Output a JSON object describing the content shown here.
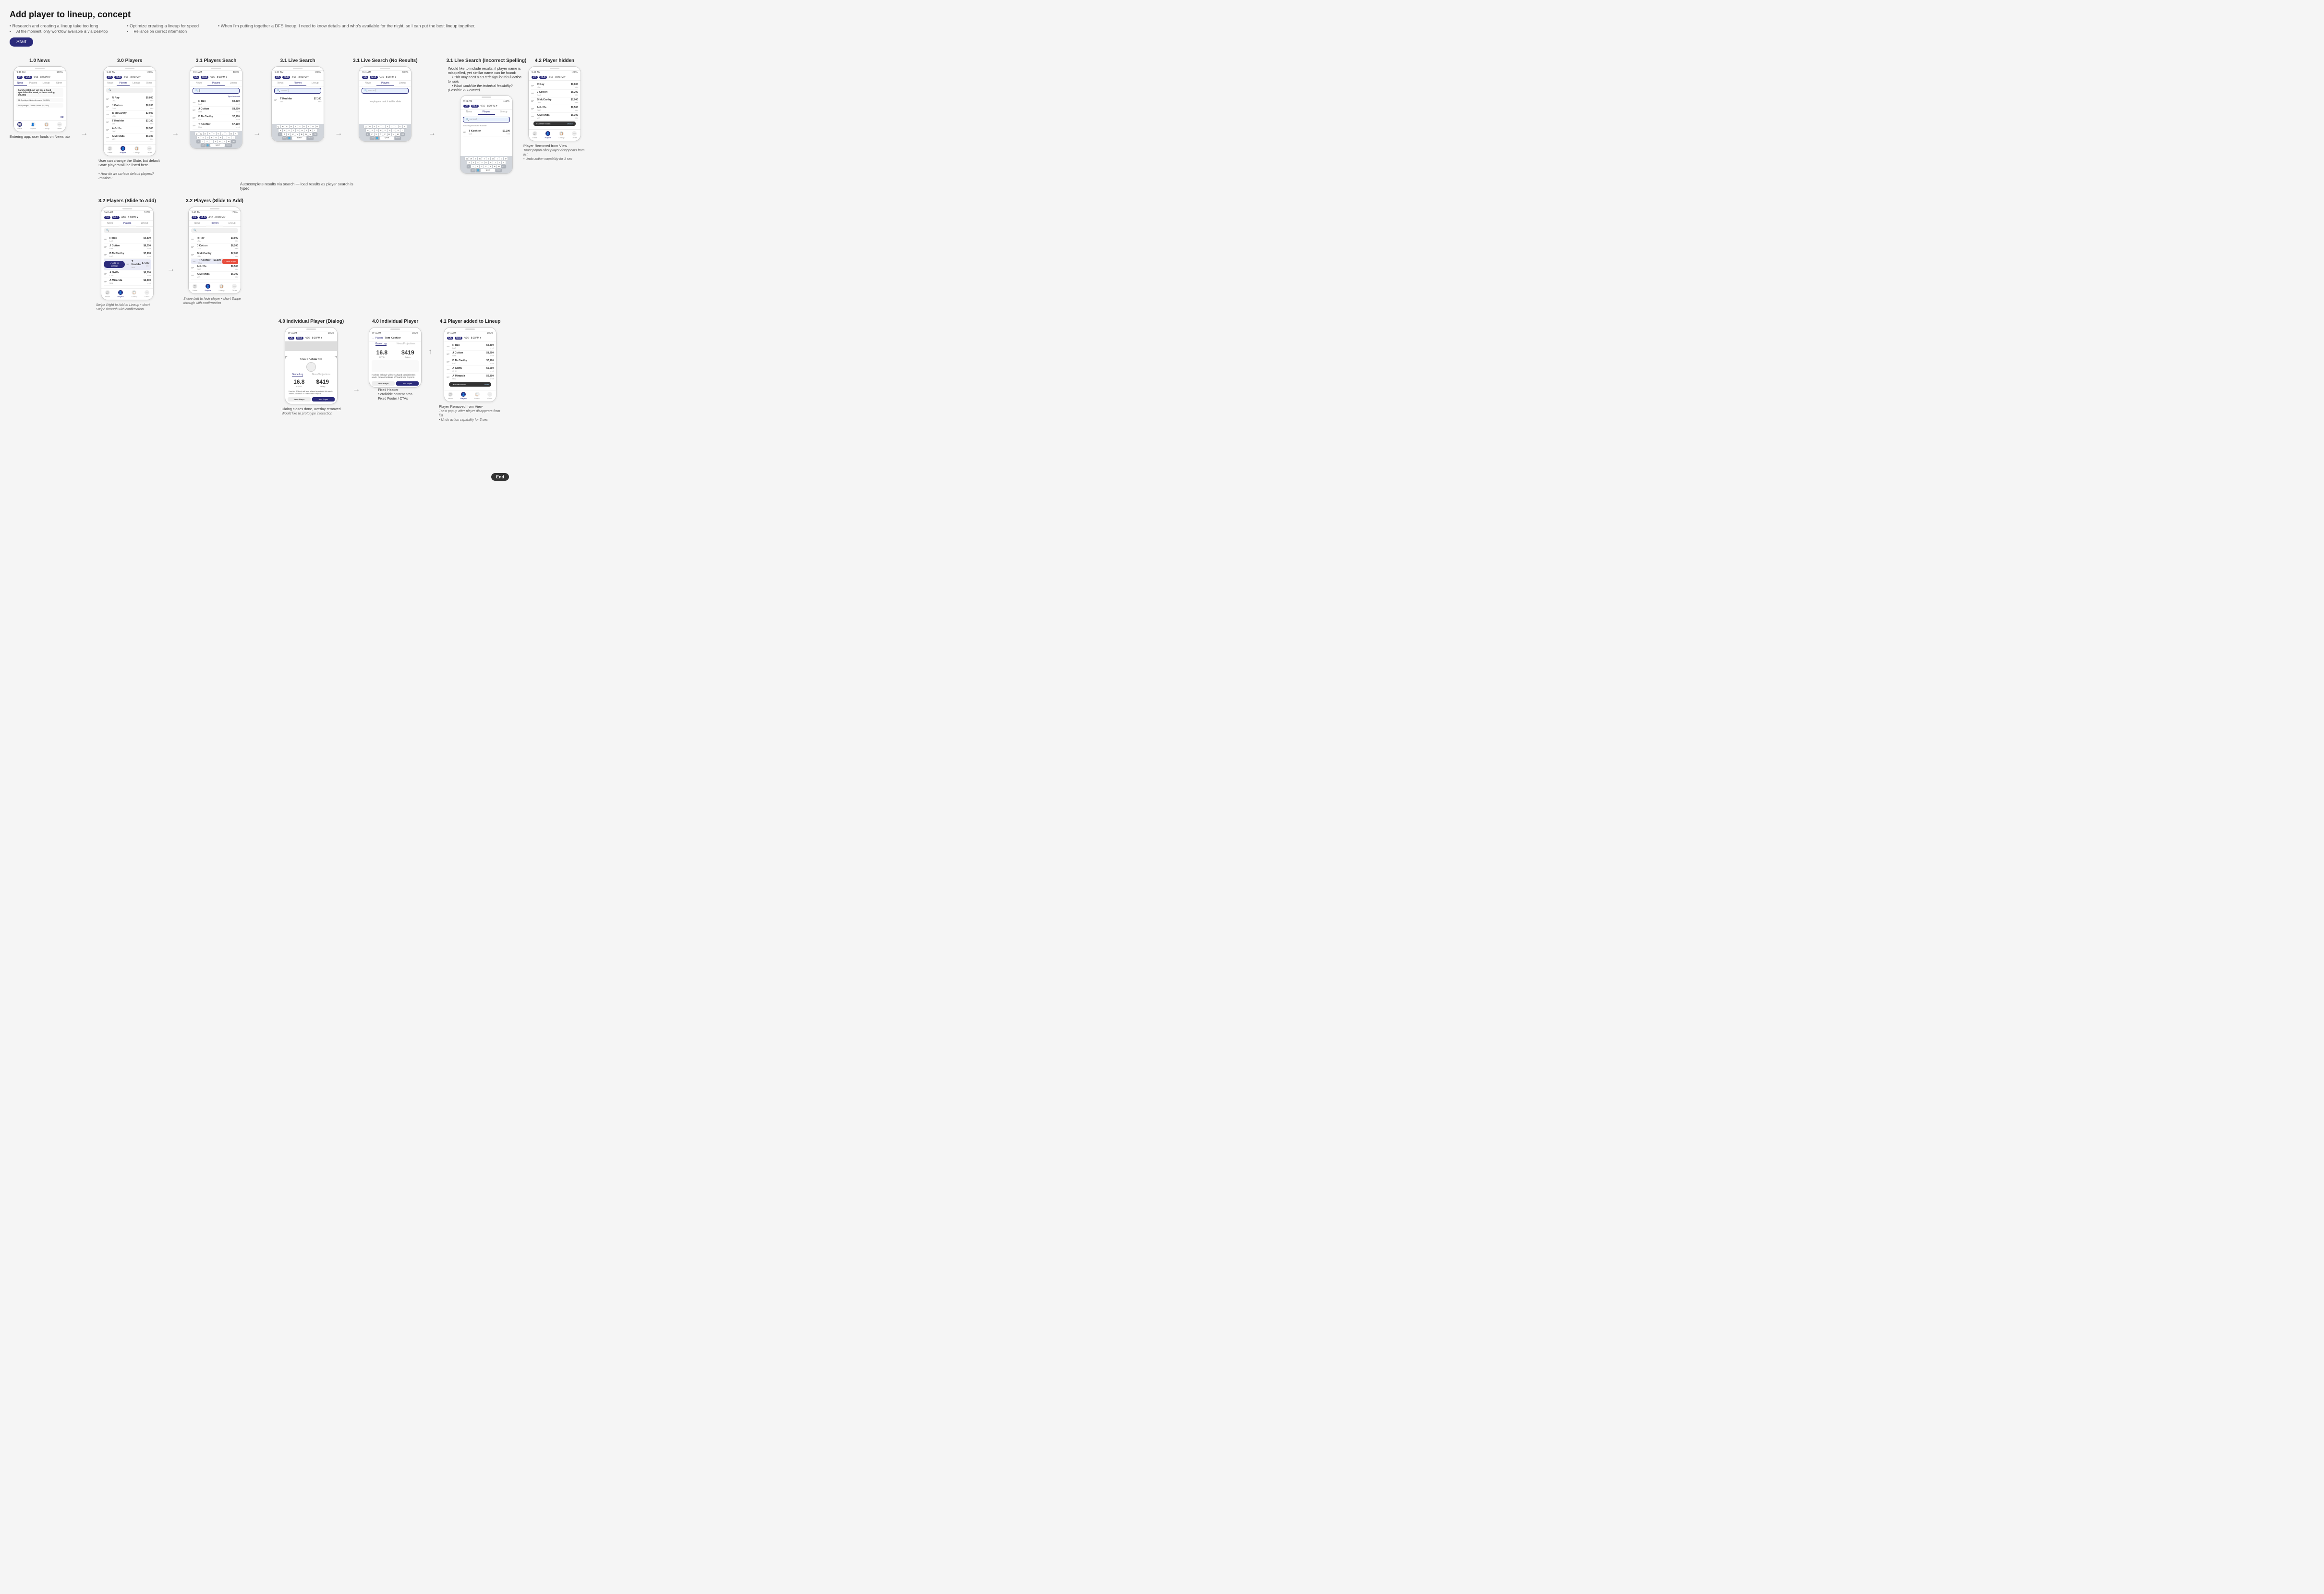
{
  "page": {
    "title": "Add player to lineup, concept",
    "subtitles": [
      {
        "text": "Research and creating a lineup take too long",
        "bullets": [
          "At the moment, only workflow available is via Desktop"
        ]
      },
      {
        "text": "Optimize creating a lineup for speed",
        "bullets": [
          "Reliance on correct information"
        ]
      },
      {
        "text": "When I'm putting together a DFS lineup, I need to know details and who's available for the night, so I can put the best lineup together."
      }
    ],
    "start_label": "Start",
    "end_label": "End"
  },
  "sections": {
    "s10": {
      "label": "1.0 News"
    },
    "s30": {
      "label": "3.0 Players"
    },
    "s31_search": {
      "label": "3.1 Players Seach"
    },
    "s31_live": {
      "label": "3.1 Live Search"
    },
    "s31_noresults": {
      "label": "3.1 Live Search (No Results)"
    },
    "s31_incorrect": {
      "label": "3.1 Live Search (Incorrect Spelling)"
    },
    "s32a": {
      "label": "3.2 Players (Slide to Add)"
    },
    "s32b": {
      "label": "3.2 Players (Slide to Add)"
    },
    "s40_dialog": {
      "label": "4.0 Individual Player (Dialog)"
    },
    "s40": {
      "label": "4.0 Individual Player"
    },
    "s41": {
      "label": "4.1 Player added to Lineup"
    },
    "s42": {
      "label": "4.2 Player hidden"
    }
  },
  "phone": {
    "status_left": "9:41 AM",
    "status_right": "100%",
    "leagues": [
      "DK",
      "MLB",
      "4/16 · 8:00PM"
    ],
    "search_placeholder": "🔍",
    "tabs": [
      "News",
      "Players",
      "Lineup",
      "Other"
    ],
    "keyboard": {
      "row1": [
        "Q",
        "W",
        "E",
        "R",
        "T",
        "Y",
        "U",
        "I",
        "O",
        "P"
      ],
      "row2": [
        "A",
        "S",
        "D",
        "F",
        "G",
        "H",
        "J",
        "K",
        "L"
      ],
      "row3": [
        "⇧",
        "Z",
        "X",
        "C",
        "V",
        "B",
        "N",
        "M",
        "⌫"
      ],
      "row4": [
        "123",
        "🌐",
        "space",
        "return"
      ]
    }
  },
  "players": [
    {
      "pos": "SP",
      "name": "R Ray",
      "team": "LAA",
      "salary": "$9,800",
      "stars": "★★★"
    },
    {
      "pos": "SP",
      "name": "J Cotton",
      "team": "OAK",
      "salary": "$8,200",
      "stars": "★★★"
    },
    {
      "pos": "SP",
      "name": "B McCarthy",
      "team": "LAD",
      "salary": "$7,900",
      "stars": "★★★"
    },
    {
      "pos": "SP",
      "name": "T Koehler",
      "team": "MIA",
      "salary": "$7,100",
      "stars": "★★★"
    },
    {
      "pos": "SP",
      "name": "A Griffs",
      "team": "CHC",
      "salary": "$6,500",
      "stars": "★★★"
    },
    {
      "pos": "SP",
      "name": "A Miranda",
      "team": "MIN",
      "salary": "$6,300",
      "stars": "★★★"
    }
  ],
  "annotations": {
    "s10": "Entering app, user lands on News tab",
    "s30_1": "User can change the Slate, but default State players will be listed here.",
    "s30_2": "• How do we surface default players? Position?",
    "s31_note": "Autocomplete results via search — load results as player search is typed",
    "s32_swipe_add": "Swipe Right to Add to Lineup • short Swipe through with confirmation",
    "s32_swipe_hide": "Swipe Left to hide player • short Swipe through with confirmation",
    "s31_noresults_text": "No players match in this slate",
    "s31_incorrect_note": "Would like to include results, if player name is misspelled, yet similar name can be found:",
    "s31_incorrect_bullets": [
      "• This may need a LB redesign for this function to work",
      "• What would be the technical feasibility? (Possible v2 feature)"
    ],
    "s40_dialog_note": "Dialog closes done, overlay removed\nWould like to prototype interaction",
    "s41_fixed_header": "Fixed Header",
    "s41_scrollable": "Scrollable content area",
    "s41_fixed_footer": "Fixed Footer / CTAs",
    "s41_player_removed": "Player Removed from View",
    "s41_toast": "Toast popup after player disappears from list\n• Undo action capability for 3 sec",
    "s42_player_removed": "Player Removed from View",
    "s42_toast": "Toast popup after player disappears from list\n• Undo action capability for 3 sec"
  },
  "no_results_text": "No players match in this slate",
  "player_dialog": {
    "name": "Tom Koehler",
    "team": "MIA",
    "fppg": "16.8",
    "salary": "$419",
    "news_title": "Koehler (Elbow) will see a hand specialist this week, Arden Zondinas of TeamFeed Reports",
    "game_log_label": "Game Log",
    "news_label": "News/Projections"
  },
  "including_results": "Including results for Koehler",
  "tap_label": "Tap",
  "search_term": "named"
}
